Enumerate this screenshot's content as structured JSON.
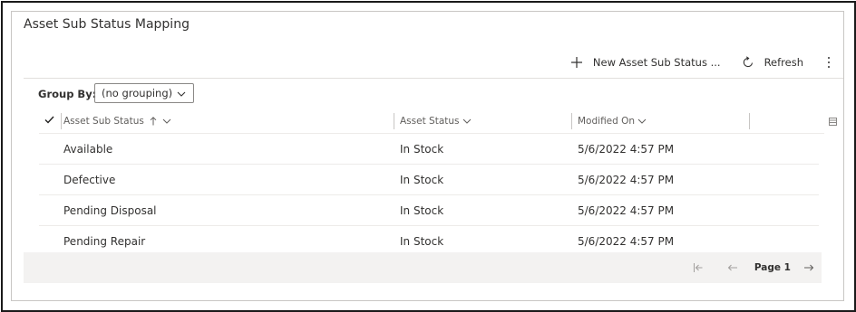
{
  "panel": {
    "title": "Asset Sub Status Mapping"
  },
  "commands": {
    "new_label": "New Asset Sub Status ...",
    "refresh_label": "Refresh"
  },
  "group_by": {
    "label": "Group By:",
    "value": "(no grouping)"
  },
  "grid": {
    "columns": [
      {
        "label": "Asset Sub Status"
      },
      {
        "label": "Asset Status"
      },
      {
        "label": "Modified On"
      }
    ],
    "rows": [
      {
        "sub_status": "Available",
        "status": "In Stock",
        "modified": "5/6/2022 4:57 PM"
      },
      {
        "sub_status": "Defective",
        "status": "In Stock",
        "modified": "5/6/2022 4:57 PM"
      },
      {
        "sub_status": "Pending Disposal",
        "status": "In Stock",
        "modified": "5/6/2022 4:57 PM"
      },
      {
        "sub_status": "Pending Repair",
        "status": "In Stock",
        "modified": "5/6/2022 4:57 PM"
      }
    ]
  },
  "pager": {
    "page_label": "Page 1"
  },
  "icons": {
    "add": "plus-icon",
    "refresh": "refresh-icon",
    "more": "more-vertical-icon",
    "chevron": "chevron-down-icon",
    "sort": "sort-ascending-icon",
    "check": "checkmark-icon",
    "first": "first-page-icon",
    "prev": "previous-page-icon",
    "next": "next-page-icon",
    "column_chooser": "column-chooser-icon"
  },
  "colors": {
    "border": "#c8c6c4",
    "text": "#323130",
    "footer_bg": "#f3f2f1"
  }
}
